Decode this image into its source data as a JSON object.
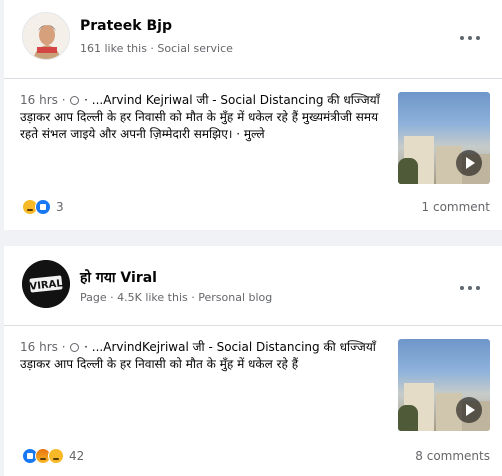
{
  "posts": [
    {
      "page_name": "Prateek Bjp",
      "page_meta": "161 like this · Social service",
      "timestamp": "16 hrs ·",
      "body": " · ...Arvind Kejriwal जी - Social Distancing की धज्जियाँ उड़ाकर आप दिल्ली के हर निवासी को मौत के मुँह में धकेल रहे हैं मुख्यमंत्रीजी समय रहते संभल जाइये और अपनी ज़िम्मेदारी समझिए। · मुल्ले",
      "reaction_count": "3",
      "comment_count": "1 comment"
    },
    {
      "page_name": "हो गया Viral",
      "page_meta": "Page · 4.5K like this · Personal blog",
      "timestamp": "16 hrs ·",
      "body": " · ...ArvindKejriwal जी - Social Distancing की धज्जियाँ उड़ाकर आप दिल्ली के हर निवासी को मौत के मुँह में धकेल रहे हैं",
      "reaction_count": "42",
      "comment_count": "8 comments",
      "avatar_text": "VIRAL"
    }
  ],
  "icons": {
    "globe": "globe-icon",
    "more": "more-options-icon",
    "play": "play-icon",
    "reactions_1": [
      "sad-reaction-icon",
      "like-reaction-icon"
    ],
    "reactions_2": [
      "like-reaction-icon",
      "angry-reaction-icon",
      "sad-reaction-icon"
    ]
  },
  "colors": {
    "background": "#f0f2f5",
    "card": "#ffffff",
    "secondary_text": "#65676b",
    "like_blue": "#1877f2",
    "reaction_yellow": "#f7b928"
  }
}
